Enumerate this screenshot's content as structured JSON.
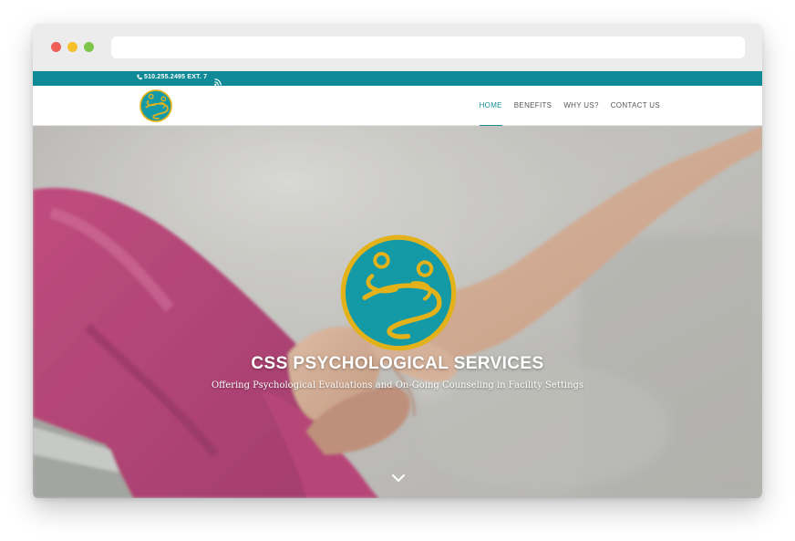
{
  "topbar": {
    "phone_text": "510.255.2495 EXT. 7",
    "phone_icon": "phone-icon",
    "rss_icon": "rss-icon",
    "color": "#0f8a96"
  },
  "nav": {
    "logo": "css-logo",
    "items": [
      {
        "label": "HOME",
        "active": true
      },
      {
        "label": "BENEFITS",
        "active": false
      },
      {
        "label": "WHY US?",
        "active": false
      },
      {
        "label": "CONTACT US",
        "active": false
      }
    ],
    "active_color": "#1a8e99"
  },
  "hero": {
    "title": "CSS PSYCHOLOGICAL SERVICES",
    "subtitle": "Offering Psychological Evaluations and On-Going Counseling in Facility Settings",
    "scroll_icon": "chevron-down-icon"
  },
  "colors": {
    "logo_teal": "#139aa6",
    "logo_gold": "#e3b21a"
  }
}
